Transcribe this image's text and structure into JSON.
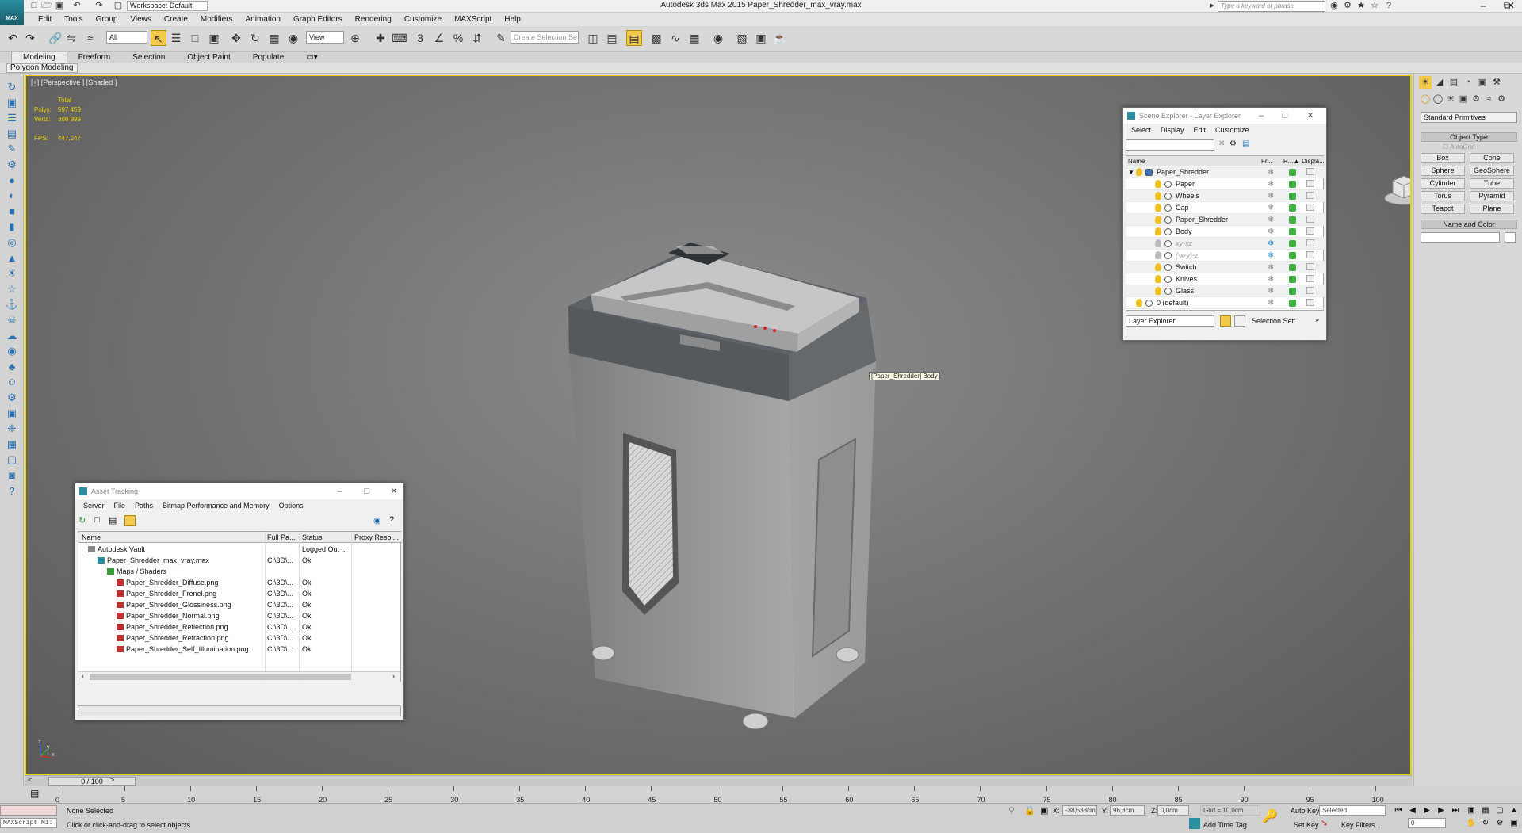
{
  "app": {
    "logo_text": "MAX",
    "title": "Autodesk 3ds Max 2015    Paper_Shredder_max_vray.max",
    "workspace": "Workspace: Default",
    "search_placeholder": "Type a keyword or phrase"
  },
  "menu": [
    "Edit",
    "Tools",
    "Group",
    "Views",
    "Create",
    "Modifiers",
    "Animation",
    "Graph Editors",
    "Rendering",
    "Customize",
    "MAXScript",
    "Help"
  ],
  "toolbar": {
    "selection_filter": "All",
    "ref_coord": "View",
    "selection_set_placeholder": "Create Selection Se"
  },
  "ribbon": {
    "tabs": [
      "Modeling",
      "Freeform",
      "Selection",
      "Object Paint",
      "Populate"
    ],
    "active_tab": "Modeling",
    "panel_button": "Polygon Modeling"
  },
  "viewport": {
    "label": "[+] [Perspective ] [Shaded ]",
    "stats": {
      "total_label": "Total",
      "polys_label": "Polys:",
      "polys_value": "597 459",
      "verts_label": "Verts:",
      "verts_value": "308 899",
      "fps_label": "FPS:",
      "fps_value": "447,247"
    },
    "tooltip": "[Paper_Shredder] Body",
    "axis_x": "x",
    "axis_y": "y",
    "axis_z": "z"
  },
  "scene_explorer": {
    "title": "Scene Explorer - Layer Explorer",
    "menu": [
      "Select",
      "Display",
      "Edit",
      "Customize"
    ],
    "columns": [
      "Name",
      "Fr...",
      "R...▲",
      "Displa..."
    ],
    "rows": [
      {
        "name": "Paper_Shredder",
        "level": 0,
        "frozen": false,
        "alt": true
      },
      {
        "name": "Paper",
        "level": 1,
        "frozen": false,
        "alt": false
      },
      {
        "name": "Wheels",
        "level": 1,
        "frozen": false,
        "alt": true
      },
      {
        "name": "Cap",
        "level": 1,
        "frozen": false,
        "alt": false
      },
      {
        "name": "Paper_Shredder",
        "level": 1,
        "frozen": false,
        "alt": true
      },
      {
        "name": "Body",
        "level": 1,
        "frozen": false,
        "alt": false
      },
      {
        "name": "xy-xz",
        "level": 1,
        "frozen": true,
        "alt": true
      },
      {
        "name": "(-x-y)-z",
        "level": 1,
        "frozen": true,
        "alt": false
      },
      {
        "name": "Switch",
        "level": 1,
        "frozen": false,
        "alt": true
      },
      {
        "name": "Knives",
        "level": 1,
        "frozen": false,
        "alt": false
      },
      {
        "name": "Glass",
        "level": 1,
        "frozen": false,
        "alt": true
      },
      {
        "name": "0 (default)",
        "level": 0,
        "frozen": false,
        "alt": false
      }
    ],
    "explorer_mode": "Layer Explorer",
    "selection_set_label": "Selection Set:"
  },
  "asset_tracking": {
    "title": "Asset Tracking",
    "menu": [
      "Server",
      "File",
      "Paths",
      "Bitmap Performance and Memory",
      "Options"
    ],
    "columns": [
      "Name",
      "Full Pa...",
      "Status",
      "Proxy Resol..."
    ],
    "rows": [
      {
        "name": "Autodesk Vault",
        "path": "",
        "status": "Logged Out ...",
        "indent": 0,
        "icon": "vault"
      },
      {
        "name": "Paper_Shredder_max_vray.max",
        "path": "C:\\3D\\...",
        "status": "Ok",
        "indent": 1,
        "icon": "max"
      },
      {
        "name": "Maps / Shaders",
        "path": "",
        "status": "",
        "indent": 2,
        "icon": "folder"
      },
      {
        "name": "Paper_Shredder_Diffuse.png",
        "path": "C:\\3D\\...",
        "status": "Ok",
        "indent": 3,
        "icon": "png"
      },
      {
        "name": "Paper_Shredder_Frenel.png",
        "path": "C:\\3D\\...",
        "status": "Ok",
        "indent": 3,
        "icon": "png"
      },
      {
        "name": "Paper_Shredder_Glossiness.png",
        "path": "C:\\3D\\...",
        "status": "Ok",
        "indent": 3,
        "icon": "png"
      },
      {
        "name": "Paper_Shredder_Normal.png",
        "path": "C:\\3D\\...",
        "status": "Ok",
        "indent": 3,
        "icon": "png"
      },
      {
        "name": "Paper_Shredder_Reflection.png",
        "path": "C:\\3D\\...",
        "status": "Ok",
        "indent": 3,
        "icon": "png"
      },
      {
        "name": "Paper_Shredder_Refraction.png",
        "path": "C:\\3D\\...",
        "status": "Ok",
        "indent": 3,
        "icon": "png"
      },
      {
        "name": "Paper_Shredder_Self_Illumination.png",
        "path": "C:\\3D\\...",
        "status": "Ok",
        "indent": 3,
        "icon": "png"
      }
    ]
  },
  "command_panel": {
    "category": "Standard Primitives",
    "object_type_header": "Object Type",
    "autogrid": "AutoGrid",
    "buttons": [
      "Box",
      "Cone",
      "Sphere",
      "GeoSphere",
      "Cylinder",
      "Tube",
      "Torus",
      "Pyramid",
      "Teapot",
      "Plane"
    ],
    "name_color_header": "Name and Color"
  },
  "timeline": {
    "frame_display": "0 / 100",
    "ticks": [
      "0",
      "5",
      "10",
      "15",
      "20",
      "25",
      "30",
      "35",
      "40",
      "45",
      "50",
      "55",
      "60",
      "65",
      "70",
      "75",
      "80",
      "85",
      "90",
      "95",
      "100"
    ]
  },
  "status": {
    "maxscript": "MAXScript Mi:",
    "selection": "None Selected",
    "prompt": "Click or click-and-drag to select objects",
    "x_label": "X:",
    "x_value": "-38,533cm",
    "y_label": "Y:",
    "y_value": "96,3cm",
    "z_label": "Z:",
    "z_value": "0,0cm",
    "grid": "Grid = 10,0cm",
    "add_time_tag": "Add Time Tag",
    "auto_key": "Auto Key",
    "auto_key_mode": "Selected",
    "set_key": "Set Key",
    "key_filters": "Key Filters...",
    "frame_field": "0"
  }
}
